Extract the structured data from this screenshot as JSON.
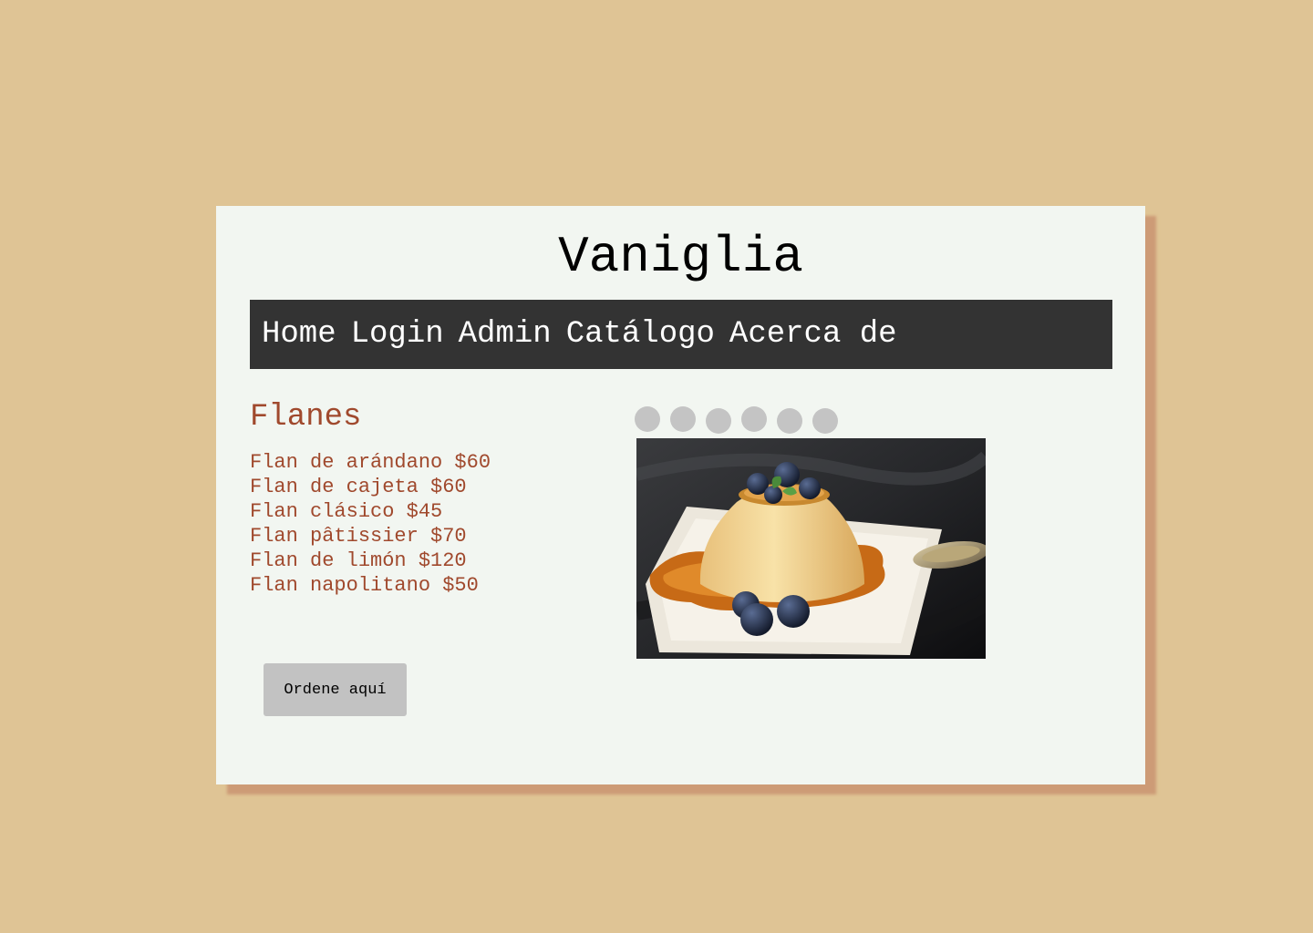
{
  "header": {
    "title": "Vaniglia"
  },
  "nav": {
    "items": [
      {
        "label": "Home"
      },
      {
        "label": "Login"
      },
      {
        "label": "Admin"
      },
      {
        "label": "Catálogo"
      },
      {
        "label": "Acerca de"
      }
    ]
  },
  "section": {
    "heading": "Flanes",
    "items": [
      {
        "text": "Flan de arándano $60"
      },
      {
        "text": "Flan de cajeta $60"
      },
      {
        "text": "Flan clásico $45"
      },
      {
        "text": "Flan pâtissier $70"
      },
      {
        "text": "Flan de limón $120"
      },
      {
        "text": "Flan napolitano $50"
      }
    ]
  },
  "order_button": {
    "label": "Ordene aquí"
  },
  "carousel": {
    "slide_count": 6,
    "image": "flan-with-blueberries-and-caramel-photo"
  },
  "colors": {
    "background": "#dfc495",
    "card": "#f2f6f1",
    "card_shadow": "#cd9b76",
    "nav_background": "#333333",
    "accent_text": "#a0492d",
    "button": "#c2c2c2",
    "dot": "#c4c4c4"
  }
}
